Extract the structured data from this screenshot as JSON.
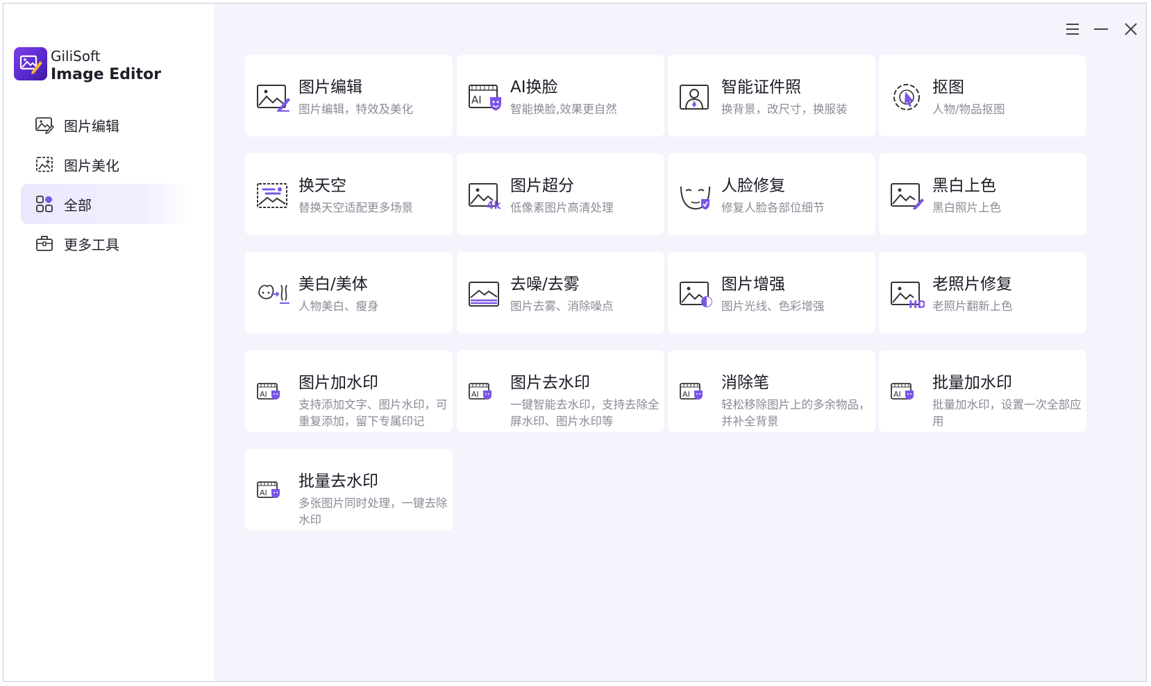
{
  "app": {
    "name_line1": "GiliSoft",
    "name_line2": "Image Editor"
  },
  "sidebar": {
    "items": [
      {
        "label": "图片编辑",
        "icon": "image-edit-icon",
        "active": false
      },
      {
        "label": "图片美化",
        "icon": "image-beautify-icon",
        "active": false
      },
      {
        "label": "全部",
        "icon": "grid-all-icon",
        "active": true
      },
      {
        "label": "更多工具",
        "icon": "toolbox-icon",
        "active": false
      }
    ]
  },
  "window_controls": {
    "menu": "menu-icon",
    "minimize": "minimize-icon",
    "close": "close-icon"
  },
  "accent_color": "#7b55e8",
  "tools": [
    {
      "title": "图片编辑",
      "desc": "图片编辑，特效及美化",
      "icon": "photo-edit-icon"
    },
    {
      "title": "AI换脸",
      "desc": "智能换脸,效果更自然",
      "icon": "ai-face-swap-icon"
    },
    {
      "title": "智能证件照",
      "desc": "换背景，改尺寸，换服装",
      "icon": "id-photo-icon"
    },
    {
      "title": "抠图",
      "desc": "人物/物品抠图",
      "icon": "cutout-icon"
    },
    {
      "title": "换天空",
      "desc": "替换天空适配更多场景",
      "icon": "sky-replace-icon"
    },
    {
      "title": "图片超分",
      "desc": "低像素图片高清处理",
      "icon": "upscale-4k-icon"
    },
    {
      "title": "人脸修复",
      "desc": "修复人脸各部位细节",
      "icon": "face-repair-icon"
    },
    {
      "title": "黑白上色",
      "desc": "黑白照片上色",
      "icon": "colorize-icon"
    },
    {
      "title": "美白/美体",
      "desc": "人物美白、瘦身",
      "icon": "body-beautify-icon"
    },
    {
      "title": "去噪/去雾",
      "desc": "图片去雾、消除噪点",
      "icon": "denoise-icon"
    },
    {
      "title": "图片增强",
      "desc": "图片光线、色彩增强",
      "icon": "enhance-icon"
    },
    {
      "title": "老照片修复",
      "desc": "老照片翻新上色",
      "icon": "old-photo-hd-icon"
    },
    {
      "title": "图片加水印",
      "desc": "支持添加文字、图片水印，可重复添加，留下专属印记",
      "icon": "ai-watermark-add-icon"
    },
    {
      "title": "图片去水印",
      "desc": "一键智能去水印，支持去除全屏水印、图片水印等",
      "icon": "ai-watermark-remove-icon"
    },
    {
      "title": "消除笔",
      "desc": "轻松移除图片上的多余物品，并补全背景",
      "icon": "ai-eraser-icon"
    },
    {
      "title": "批量加水印",
      "desc": "批量加水印，设置一次全部应用",
      "icon": "ai-batch-watermark-icon"
    },
    {
      "title": "批量去水印",
      "desc": "多张图片同时处理，一键去除水印",
      "icon": "ai-batch-remove-icon"
    }
  ]
}
